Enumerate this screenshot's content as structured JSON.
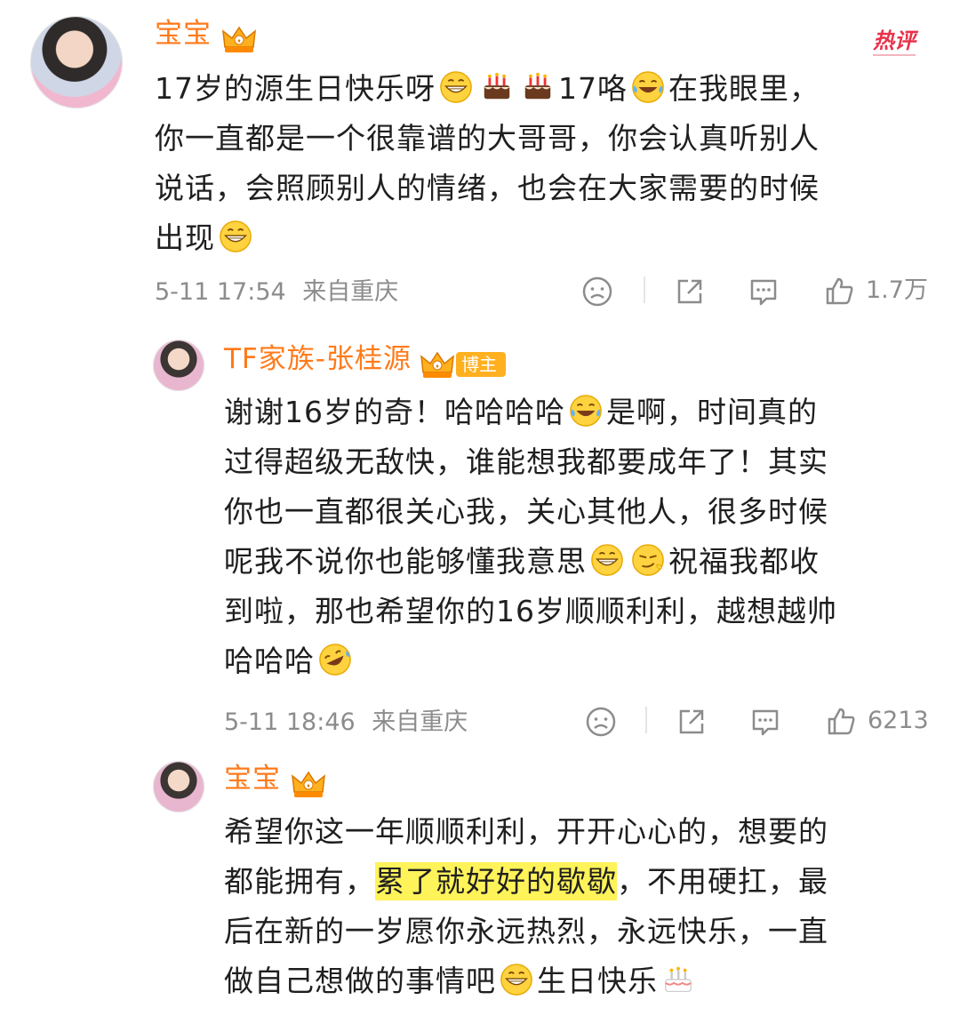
{
  "comment1": {
    "user_name": "宝宝",
    "hot_label": "热评",
    "text_lines": [
      "17岁的源生日快乐呀",
      "你一直都是一个很靠谱的大哥哥，你会认真听别人",
      "说话，会照顾别人的情绪，也会在大家需要的时候",
      "出现"
    ],
    "inline_17": "17",
    "inline_lo": "咯",
    "inline_rest": "在我眼里，",
    "time": "5-11 17:54",
    "location": "来自重庆",
    "like_count": "1.7万"
  },
  "reply1": {
    "user_name": "TF家族-张桂源",
    "badge": "博主",
    "text_lines": [
      "谢谢16岁的奇！哈哈哈哈",
      "是啊，时间真的",
      "过得超级无敌快，谁能想我都要成年了！其实",
      "你也一直都很关心我，关心其他人，很多时候",
      "呢我不说你也能够懂我意思",
      "祝福我都收",
      "到啦，那也希望你的16岁顺顺利利，越想越帅",
      "哈哈哈"
    ],
    "time": "5-11 18:46",
    "location": "来自重庆",
    "like_count": "6213"
  },
  "reply2": {
    "user_name": "宝宝",
    "text_lines": [
      "希望你这一年顺顺利利，开开心心的，想要的",
      "都能拥有，",
      "累了就好好的歇歇",
      "，不用硬扛，最",
      "后在新的一岁愿你永远热烈，永远快乐，一直",
      "做自己想做的事情吧",
      "生日快乐"
    ]
  },
  "colors": {
    "name": "#ff7a1a",
    "hot": "#e8324b",
    "highlight": "#fff35a",
    "meta": "#8c8c8c"
  },
  "icons": [
    "crown-icon",
    "grin-emoji",
    "cake-emoji",
    "laugh-cry-emoji",
    "smirk-emoji",
    "rofl-emoji",
    "dislike-icon",
    "share-icon",
    "comment-icon",
    "like-icon"
  ]
}
